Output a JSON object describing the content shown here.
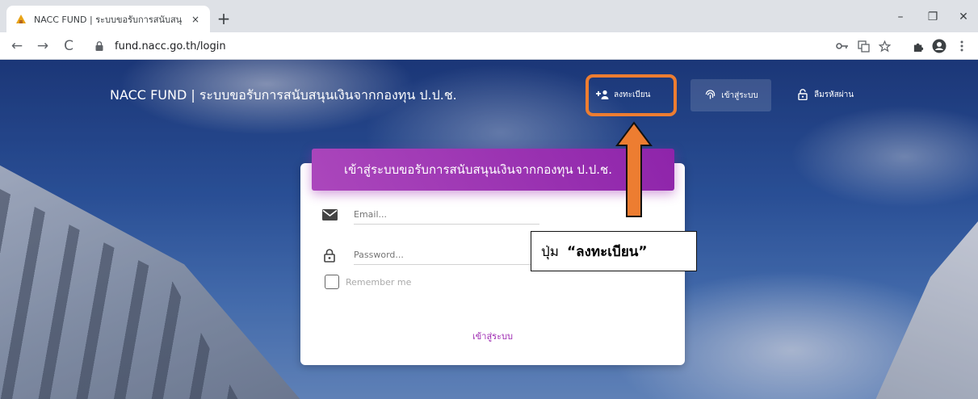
{
  "browser": {
    "tab_title": "NACC FUND | ระบบขอรับการสนับสนุ",
    "tab_close": "×",
    "new_tab": "+",
    "url": "fund.nacc.go.th/login",
    "minimize": "–",
    "restore": "❐",
    "close": "✕",
    "back": "←",
    "forward": "→",
    "reload": "C"
  },
  "navbar": {
    "brand": "NACC FUND | ระบบขอรับการสนับสนุนเงินจากกองทุน ป.ป.ช.",
    "register_label": "ลงทะเบียน",
    "login_label": "เข้าสู่ระบบ",
    "forgot_label": "ลืมรหัสผ่าน"
  },
  "login_card": {
    "header": "เข้าสู่ระบบขอรับการสนับสนุนเงินจากกองทุน ป.ป.ช.",
    "email_placeholder": "Email...",
    "password_placeholder": "Password...",
    "remember_label": "Remember me",
    "submit_label": "เข้าสู่ระบบ"
  },
  "annotation": {
    "callout_prefix": "ปุ่ม",
    "callout_button": "“ลงทะเบียน”",
    "highlight_color": "#ed7d31"
  },
  "colors": {
    "accent_purple": "#9c27b0",
    "annotation_orange": "#ed7d31"
  }
}
